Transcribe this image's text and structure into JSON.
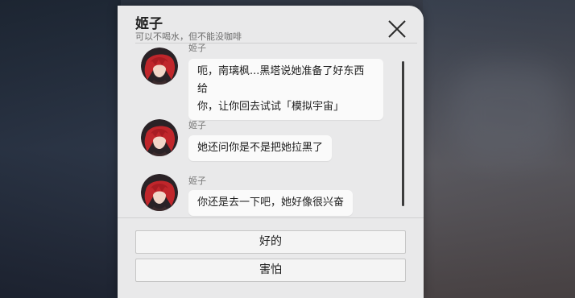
{
  "dialog": {
    "title": "姬子",
    "subtitle": "可以不喝水，但不能没咖啡"
  },
  "messages": [
    {
      "sender": "姬子",
      "lines": [
        "呃，南璃枫...黑塔说她准备了好东西给",
        "你，让你回去试试「模拟宇宙」"
      ]
    },
    {
      "sender": "姬子",
      "lines": [
        "她还问你是不是把她拉黑了"
      ]
    },
    {
      "sender": "姬子",
      "lines": [
        "你还是去一下吧，她好像很兴奋"
      ]
    }
  ],
  "options": [
    {
      "label": "好的"
    },
    {
      "label": "害怕"
    }
  ],
  "colors": {
    "panel_bg": "#e9e9ea",
    "bubble_bg": "#fafafa",
    "avatar_hair": "#c0262b"
  },
  "icons": {
    "close": "close-icon"
  }
}
